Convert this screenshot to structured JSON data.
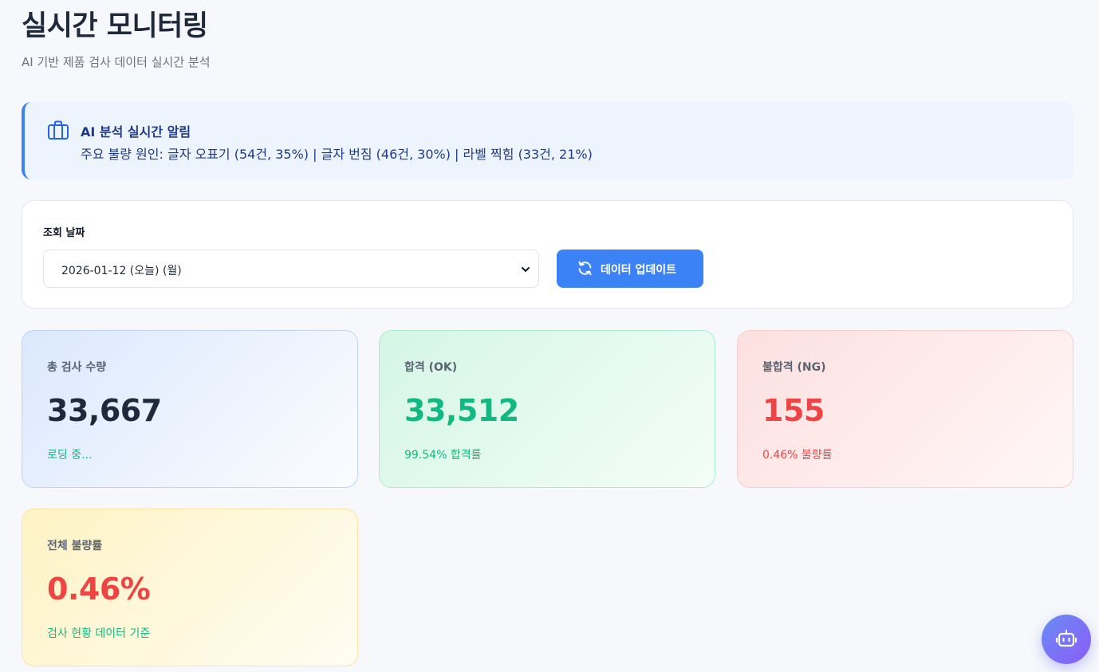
{
  "page": {
    "title": "실시간 모니터링",
    "subtitle": "AI 기반 제품 검사 데이터 실시간 분석"
  },
  "alert": {
    "icon": "briefcase-icon",
    "title": "AI 분석 실시간 알림",
    "message": "주요 불량 원인: 글자 오표기 (54건, 35%) | 글자 번짐 (46건, 30%) | 라벨 찍힘 (33건, 21%)"
  },
  "filter": {
    "label": "조회 날짜",
    "selected_date": "2026-01-12 (오늘) (월)",
    "update_button": "데이터 업데이트",
    "update_icon": "refresh-icon"
  },
  "stats": [
    {
      "label": "총 검사 수량",
      "value": "33,667",
      "sub": "로딩 중...",
      "accent": "#3b82f6"
    },
    {
      "label": "합격 (OK)",
      "value": "33,512",
      "sub": "99.54% 합격률",
      "accent": "#10b981"
    },
    {
      "label": "불합격 (NG)",
      "value": "155",
      "sub": "0.46% 불량률",
      "accent": "#ef4444"
    },
    {
      "label": "전체 불량률",
      "value": "0.46%",
      "sub": "검사 현황 데이터 기준",
      "accent": "#f59e0b"
    }
  ],
  "chatbot": {
    "icon": "robot-icon"
  },
  "colors": {
    "primary": "#3b82f6",
    "success": "#10b981",
    "danger": "#ef4444",
    "alert_bg": "#eef4fe"
  }
}
